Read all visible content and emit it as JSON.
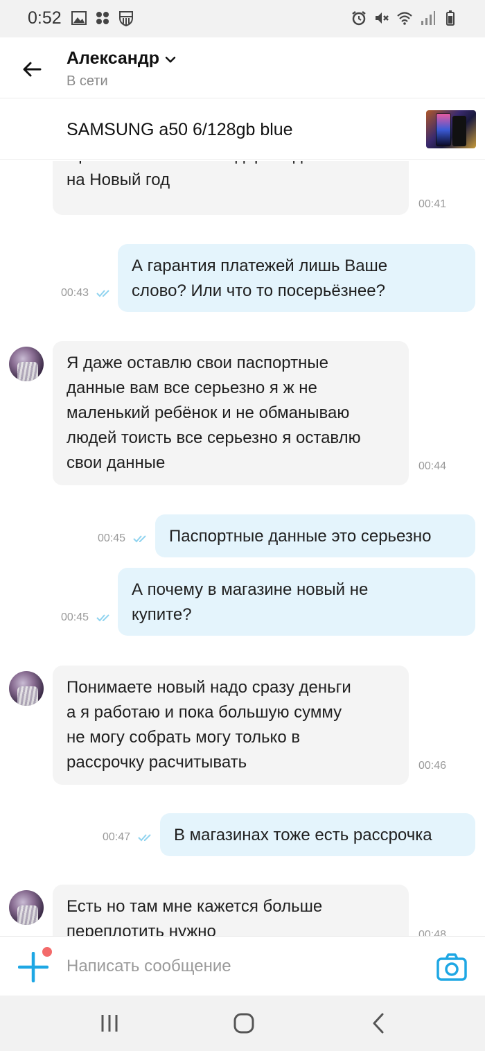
{
  "status_bar": {
    "time": "0:52",
    "left_icons": [
      "gallery-icon",
      "app-icon",
      "fc-barcelona-icon"
    ],
    "right_icons": [
      "alarm-icon",
      "mute-icon",
      "wifi-icon",
      "signal-icon",
      "battery-icon"
    ]
  },
  "header": {
    "contact_name": "Александр",
    "contact_status": "В сети"
  },
  "listing": {
    "title": "SAMSUNG a50 6/128gb blue"
  },
  "messages": [
    {
      "direction": "in",
      "text": "Просто хотел жене подарок сделать\nна Новый год",
      "time": "00:41",
      "avatar": false
    },
    {
      "direction": "out",
      "text": "А гарантия платежей лишь Ваше\nслово? Или что то посерьёзнее?",
      "time": "00:43",
      "read": true
    },
    {
      "direction": "in",
      "text": "Я даже оставлю свои паспортные\nданные вам все серьезно я ж не\nмаленький ребёнок  и не обманываю\nлюдей тоисть все серьезно я оставлю\nсвои данные",
      "time": "00:44",
      "avatar": true
    },
    {
      "direction": "out",
      "text": "Паспортные данные это серьезно",
      "time": "00:45",
      "read": true
    },
    {
      "direction": "out",
      "text": "А почему в магазине новый не\nкупите?",
      "time": "00:45",
      "read": true
    },
    {
      "direction": "in",
      "text": "Понимаете новый надо сразу деньги\nа я работаю и пока большую сумму\nне могу собрать могу только в\nрассрочку  расчитывать",
      "time": "00:46",
      "avatar": true
    },
    {
      "direction": "out",
      "text": "В магазинах тоже есть рассрочка",
      "time": "00:47",
      "read": true
    },
    {
      "direction": "in",
      "text": "Есть но там мне кажется больше\nпереплотить нужно",
      "time": "00:48",
      "avatar": true
    }
  ],
  "composer": {
    "placeholder": "Написать сообщение"
  },
  "colors": {
    "accent": "#1ea7e4",
    "incoming_bubble": "#f4f4f4",
    "outgoing_bubble": "#e4f4fc",
    "notification_dot": "#f36a6a"
  }
}
